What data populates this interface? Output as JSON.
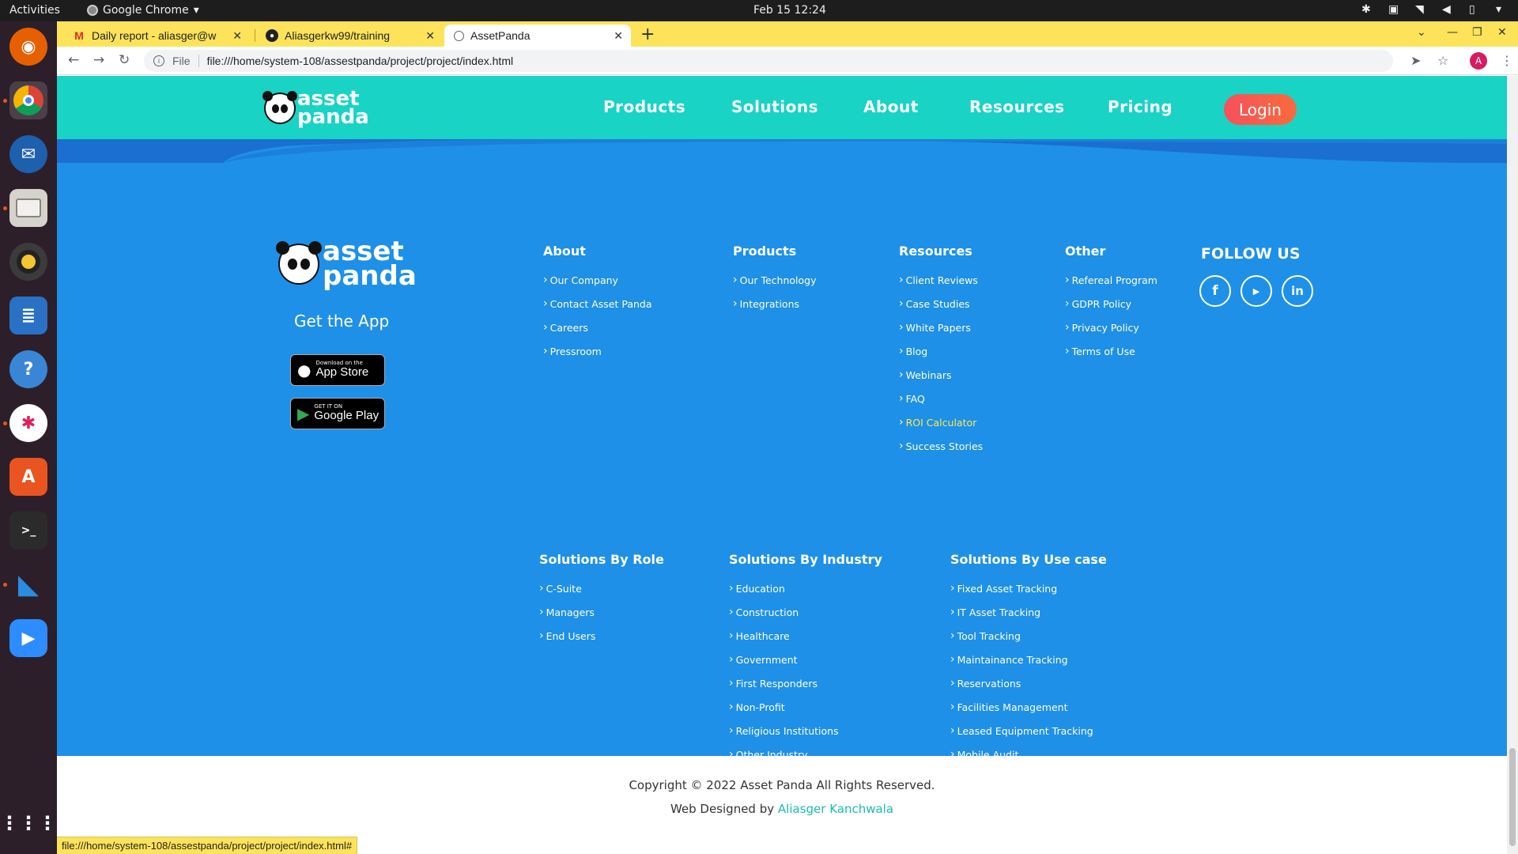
{
  "os": {
    "activities": "Activities",
    "app_name": "Google Chrome",
    "clock": "Feb 15  12:24"
  },
  "browser": {
    "tabs": [
      {
        "label": "Daily report - aliasger@w",
        "icon": "gmail-icon"
      },
      {
        "label": "Aliasgerkw99/training",
        "icon": "github-icon"
      },
      {
        "label": "AssetPanda",
        "icon": "globe-icon"
      }
    ],
    "url_scheme": "File",
    "url": "file:///home/system-108/assestpanda/project/project/index.html",
    "profile_initial": "A",
    "status_url": "file:///home/system-108/assestpanda/project/project/index.html#"
  },
  "site": {
    "logo": {
      "line1": "asset",
      "line2": "panda"
    },
    "nav": [
      "Products",
      "Solutions",
      "About",
      "Resources",
      "Pricing"
    ],
    "login": "Login",
    "colors": {
      "header": "#19d3c5",
      "footer": "#1e90e8",
      "login": "#f7505c",
      "highlight": "#ffe94d"
    }
  },
  "footer": {
    "get_app": "Get the App",
    "app_store": {
      "small": "Download on the",
      "big": "App Store"
    },
    "google_play": {
      "small": "GET IT ON",
      "big": "Google Play"
    },
    "about": {
      "title": "About",
      "links": [
        "Our Company",
        "Contact Asset Panda",
        "Careers",
        "Pressroom"
      ]
    },
    "products": {
      "title": "Products",
      "links": [
        "Our Technology",
        "Integrations"
      ]
    },
    "resources": {
      "title": "Resources",
      "links": [
        "Client Reviews",
        "Case Studies",
        "White Papers",
        "Blog",
        "Webinars",
        "FAQ",
        "ROI Calculator",
        "Success Stories"
      ]
    },
    "other": {
      "title": "Other",
      "links": [
        "Refereal Program",
        "GDPR Policy",
        "Privacy Policy",
        "Terms of Use"
      ]
    },
    "follow": {
      "title": "FOLLOW US",
      "icons": [
        "facebook-icon",
        "youtube-icon",
        "linkedin-icon"
      ]
    },
    "by_role": {
      "title": "Solutions By Role",
      "links": [
        "C-Suite",
        "Managers",
        "End Users"
      ]
    },
    "by_industry": {
      "title": "Solutions By Industry",
      "links": [
        "Education",
        "Construction",
        "Healthcare",
        "Government",
        "First Responders",
        "Non-Profit",
        "Religious Institutions",
        "Other Industry"
      ]
    },
    "by_usecase": {
      "title": "Solutions By Use case",
      "links": [
        "Fixed Asset Tracking",
        "IT Asset Tracking",
        "Tool Tracking",
        "Maintainance Tracking",
        "Reservations",
        "Facilities Management",
        "Leased Equipment Tracking",
        "Mobile Audit"
      ]
    },
    "copyright": "Copyright © 2022 Asset Panda All Rights Reserved.",
    "credit_prefix": "Web Designed by",
    "credit_author": "Aliasger Kanchwala"
  }
}
